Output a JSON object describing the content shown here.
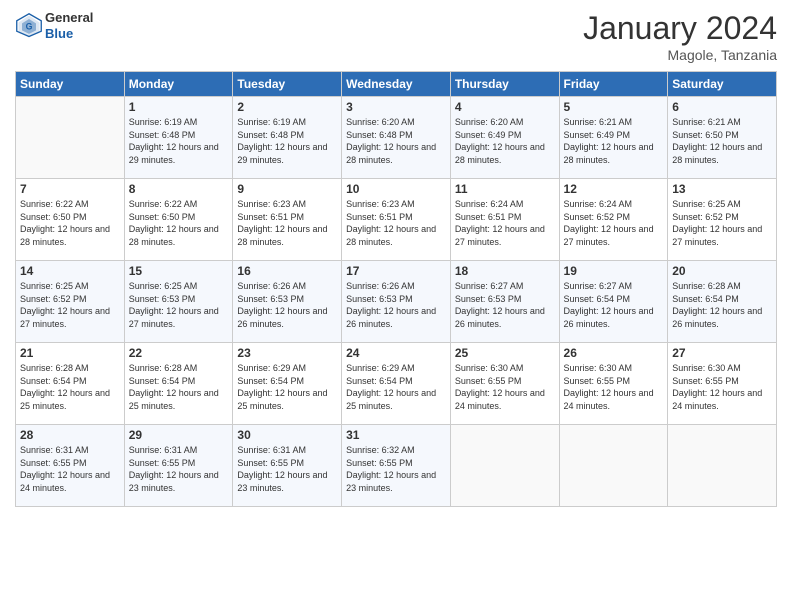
{
  "header": {
    "logo_general": "General",
    "logo_blue": "Blue",
    "title": "January 2024",
    "subtitle": "Magole, Tanzania"
  },
  "days_of_week": [
    "Sunday",
    "Monday",
    "Tuesday",
    "Wednesday",
    "Thursday",
    "Friday",
    "Saturday"
  ],
  "weeks": [
    [
      {
        "day": "",
        "sunrise": "",
        "sunset": "",
        "daylight": ""
      },
      {
        "day": "1",
        "sunrise": "Sunrise: 6:19 AM",
        "sunset": "Sunset: 6:48 PM",
        "daylight": "Daylight: 12 hours and 29 minutes."
      },
      {
        "day": "2",
        "sunrise": "Sunrise: 6:19 AM",
        "sunset": "Sunset: 6:48 PM",
        "daylight": "Daylight: 12 hours and 29 minutes."
      },
      {
        "day": "3",
        "sunrise": "Sunrise: 6:20 AM",
        "sunset": "Sunset: 6:48 PM",
        "daylight": "Daylight: 12 hours and 28 minutes."
      },
      {
        "day": "4",
        "sunrise": "Sunrise: 6:20 AM",
        "sunset": "Sunset: 6:49 PM",
        "daylight": "Daylight: 12 hours and 28 minutes."
      },
      {
        "day": "5",
        "sunrise": "Sunrise: 6:21 AM",
        "sunset": "Sunset: 6:49 PM",
        "daylight": "Daylight: 12 hours and 28 minutes."
      },
      {
        "day": "6",
        "sunrise": "Sunrise: 6:21 AM",
        "sunset": "Sunset: 6:50 PM",
        "daylight": "Daylight: 12 hours and 28 minutes."
      }
    ],
    [
      {
        "day": "7",
        "sunrise": "Sunrise: 6:22 AM",
        "sunset": "Sunset: 6:50 PM",
        "daylight": "Daylight: 12 hours and 28 minutes."
      },
      {
        "day": "8",
        "sunrise": "Sunrise: 6:22 AM",
        "sunset": "Sunset: 6:50 PM",
        "daylight": "Daylight: 12 hours and 28 minutes."
      },
      {
        "day": "9",
        "sunrise": "Sunrise: 6:23 AM",
        "sunset": "Sunset: 6:51 PM",
        "daylight": "Daylight: 12 hours and 28 minutes."
      },
      {
        "day": "10",
        "sunrise": "Sunrise: 6:23 AM",
        "sunset": "Sunset: 6:51 PM",
        "daylight": "Daylight: 12 hours and 28 minutes."
      },
      {
        "day": "11",
        "sunrise": "Sunrise: 6:24 AM",
        "sunset": "Sunset: 6:51 PM",
        "daylight": "Daylight: 12 hours and 27 minutes."
      },
      {
        "day": "12",
        "sunrise": "Sunrise: 6:24 AM",
        "sunset": "Sunset: 6:52 PM",
        "daylight": "Daylight: 12 hours and 27 minutes."
      },
      {
        "day": "13",
        "sunrise": "Sunrise: 6:25 AM",
        "sunset": "Sunset: 6:52 PM",
        "daylight": "Daylight: 12 hours and 27 minutes."
      }
    ],
    [
      {
        "day": "14",
        "sunrise": "Sunrise: 6:25 AM",
        "sunset": "Sunset: 6:52 PM",
        "daylight": "Daylight: 12 hours and 27 minutes."
      },
      {
        "day": "15",
        "sunrise": "Sunrise: 6:25 AM",
        "sunset": "Sunset: 6:53 PM",
        "daylight": "Daylight: 12 hours and 27 minutes."
      },
      {
        "day": "16",
        "sunrise": "Sunrise: 6:26 AM",
        "sunset": "Sunset: 6:53 PM",
        "daylight": "Daylight: 12 hours and 26 minutes."
      },
      {
        "day": "17",
        "sunrise": "Sunrise: 6:26 AM",
        "sunset": "Sunset: 6:53 PM",
        "daylight": "Daylight: 12 hours and 26 minutes."
      },
      {
        "day": "18",
        "sunrise": "Sunrise: 6:27 AM",
        "sunset": "Sunset: 6:53 PM",
        "daylight": "Daylight: 12 hours and 26 minutes."
      },
      {
        "day": "19",
        "sunrise": "Sunrise: 6:27 AM",
        "sunset": "Sunset: 6:54 PM",
        "daylight": "Daylight: 12 hours and 26 minutes."
      },
      {
        "day": "20",
        "sunrise": "Sunrise: 6:28 AM",
        "sunset": "Sunset: 6:54 PM",
        "daylight": "Daylight: 12 hours and 26 minutes."
      }
    ],
    [
      {
        "day": "21",
        "sunrise": "Sunrise: 6:28 AM",
        "sunset": "Sunset: 6:54 PM",
        "daylight": "Daylight: 12 hours and 25 minutes."
      },
      {
        "day": "22",
        "sunrise": "Sunrise: 6:28 AM",
        "sunset": "Sunset: 6:54 PM",
        "daylight": "Daylight: 12 hours and 25 minutes."
      },
      {
        "day": "23",
        "sunrise": "Sunrise: 6:29 AM",
        "sunset": "Sunset: 6:54 PM",
        "daylight": "Daylight: 12 hours and 25 minutes."
      },
      {
        "day": "24",
        "sunrise": "Sunrise: 6:29 AM",
        "sunset": "Sunset: 6:54 PM",
        "daylight": "Daylight: 12 hours and 25 minutes."
      },
      {
        "day": "25",
        "sunrise": "Sunrise: 6:30 AM",
        "sunset": "Sunset: 6:55 PM",
        "daylight": "Daylight: 12 hours and 24 minutes."
      },
      {
        "day": "26",
        "sunrise": "Sunrise: 6:30 AM",
        "sunset": "Sunset: 6:55 PM",
        "daylight": "Daylight: 12 hours and 24 minutes."
      },
      {
        "day": "27",
        "sunrise": "Sunrise: 6:30 AM",
        "sunset": "Sunset: 6:55 PM",
        "daylight": "Daylight: 12 hours and 24 minutes."
      }
    ],
    [
      {
        "day": "28",
        "sunrise": "Sunrise: 6:31 AM",
        "sunset": "Sunset: 6:55 PM",
        "daylight": "Daylight: 12 hours and 24 minutes."
      },
      {
        "day": "29",
        "sunrise": "Sunrise: 6:31 AM",
        "sunset": "Sunset: 6:55 PM",
        "daylight": "Daylight: 12 hours and 23 minutes."
      },
      {
        "day": "30",
        "sunrise": "Sunrise: 6:31 AM",
        "sunset": "Sunset: 6:55 PM",
        "daylight": "Daylight: 12 hours and 23 minutes."
      },
      {
        "day": "31",
        "sunrise": "Sunrise: 6:32 AM",
        "sunset": "Sunset: 6:55 PM",
        "daylight": "Daylight: 12 hours and 23 minutes."
      },
      {
        "day": "",
        "sunrise": "",
        "sunset": "",
        "daylight": ""
      },
      {
        "day": "",
        "sunrise": "",
        "sunset": "",
        "daylight": ""
      },
      {
        "day": "",
        "sunrise": "",
        "sunset": "",
        "daylight": ""
      }
    ]
  ]
}
